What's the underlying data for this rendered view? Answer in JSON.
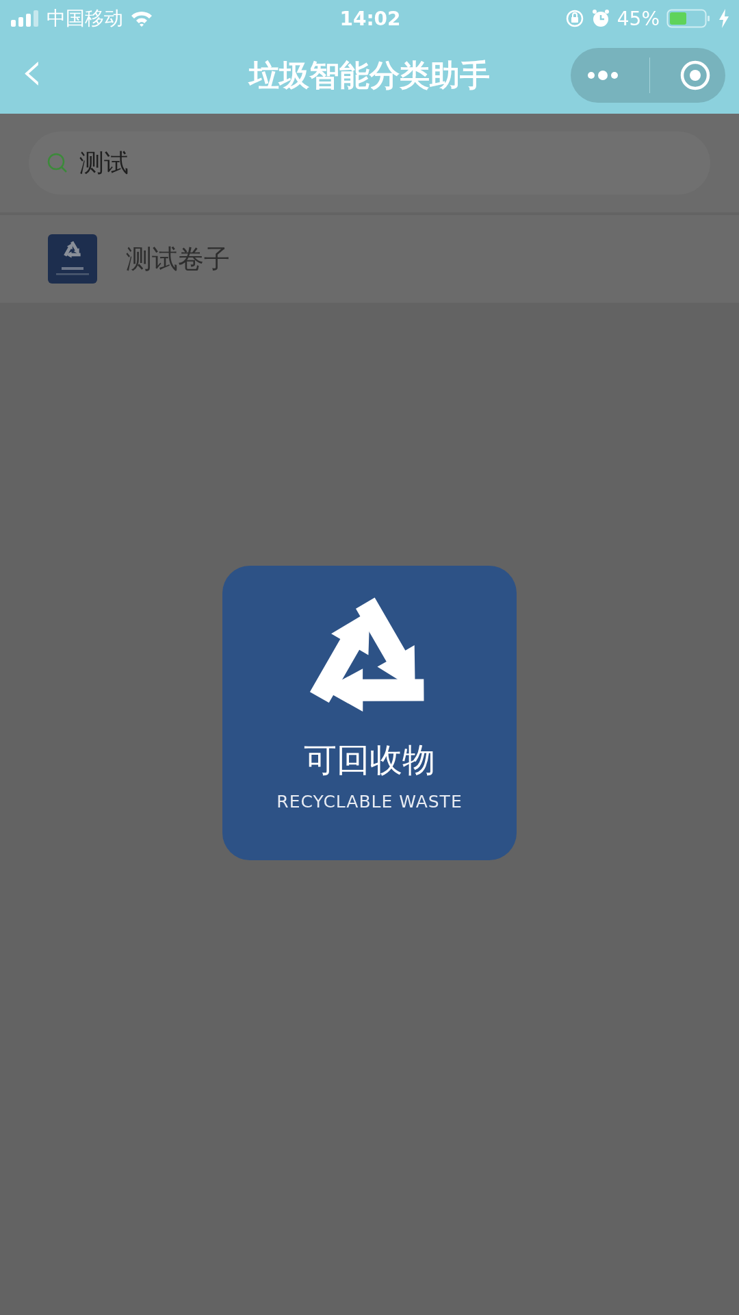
{
  "status_bar": {
    "carrier": "中国移动",
    "time": "14:02",
    "battery": "45%"
  },
  "nav_bar": {
    "back": "‹",
    "title": "垃圾智能分类助手"
  },
  "search": {
    "value": "测试"
  },
  "results": [
    {
      "name": "测试卷子"
    }
  ],
  "popup": {
    "title": "可回收物",
    "subtitle": "RECYCLABLE WASTE"
  }
}
